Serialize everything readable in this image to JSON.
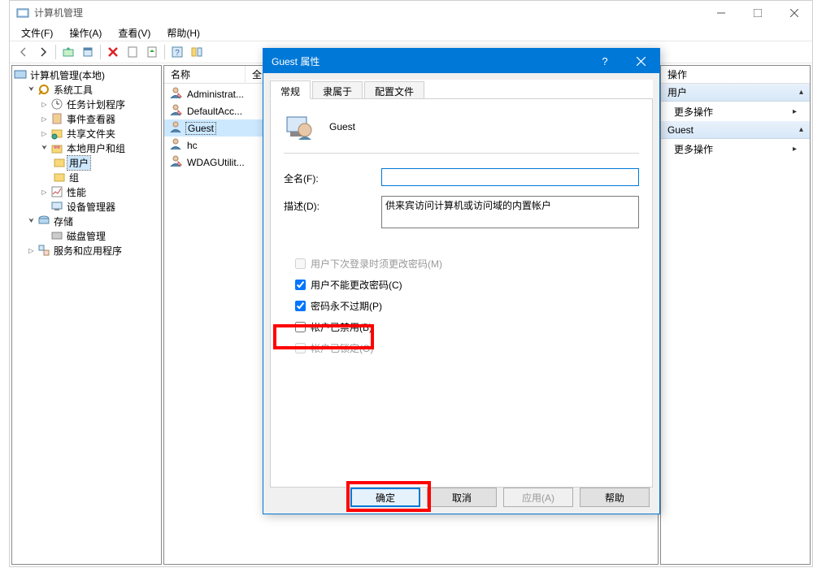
{
  "window": {
    "title": "计算机管理",
    "menu": {
      "file": "文件(F)",
      "action": "操作(A)",
      "view": "查看(V)",
      "help": "帮助(H)"
    }
  },
  "tree": {
    "root": "计算机管理(本地)",
    "system_tools": "系统工具",
    "task_scheduler": "任务计划程序",
    "event_viewer": "事件查看器",
    "shared_folders": "共享文件夹",
    "local_users_groups": "本地用户和组",
    "users": "用户",
    "groups": "组",
    "performance": "性能",
    "device_manager": "设备管理器",
    "storage": "存储",
    "disk_management": "磁盘管理",
    "services_apps": "服务和应用程序"
  },
  "list": {
    "header_name": "名称",
    "header_full": "全",
    "rows": [
      {
        "name": "Administrat..."
      },
      {
        "name": "DefaultAcc..."
      },
      {
        "name": "Guest"
      },
      {
        "name": "hc"
      },
      {
        "name": "WDAGUtilit..."
      }
    ]
  },
  "actions": {
    "header": "操作",
    "users": "用户",
    "more_actions": "更多操作",
    "guest": "Guest"
  },
  "dialog": {
    "title": "Guest 属性",
    "tabs": {
      "general": "常规",
      "member_of": "隶属于",
      "profile": "配置文件"
    },
    "account_name": "Guest",
    "label_fullname": "全名(F):",
    "label_description": "描述(D):",
    "fullname_value": "",
    "description_value": "供来宾访问计算机或访问域的内置帐户",
    "check_must_change": "用户下次登录时须更改密码(M)",
    "check_cannot_change": "用户不能更改密码(C)",
    "check_never_expire": "密码永不过期(P)",
    "check_disabled": "帐户已禁用(B)",
    "check_locked": "帐户已锁定(O)",
    "buttons": {
      "ok": "确定",
      "cancel": "取消",
      "apply": "应用(A)",
      "help": "帮助"
    }
  }
}
